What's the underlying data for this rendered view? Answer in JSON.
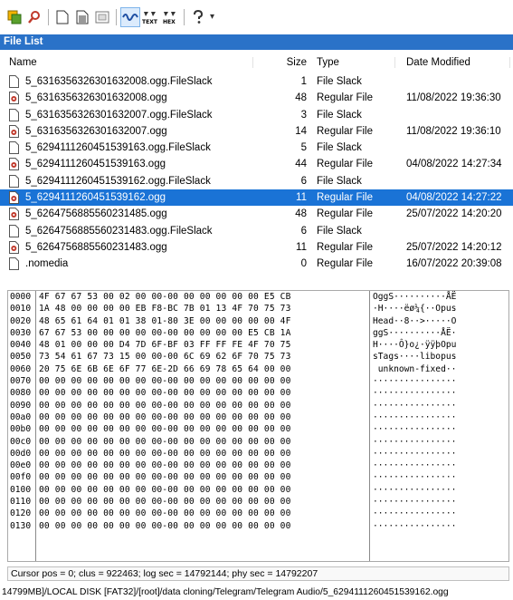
{
  "toolbar": {
    "icons": [
      "copy-icon",
      "search-icon",
      "blank-page-icon",
      "document-icon",
      "image-icon",
      "wave-icon",
      "text-view-icon",
      "hex-view-icon",
      "help-icon"
    ]
  },
  "file_list": {
    "title": "File List",
    "columns": {
      "name": "Name",
      "size": "Size",
      "type": "Type",
      "date": "Date Modified"
    },
    "rows": [
      {
        "name": "5_6316356326301632008.ogg.FileSlack",
        "size": "1",
        "type": "File Slack",
        "date": "",
        "icon": "page-icon"
      },
      {
        "name": "5_6316356326301632008.ogg",
        "size": "48",
        "type": "Regular File",
        "date": "11/08/2022 19:36:30",
        "icon": "audio-file-icon"
      },
      {
        "name": "5_6316356326301632007.ogg.FileSlack",
        "size": "3",
        "type": "File Slack",
        "date": "",
        "icon": "page-icon"
      },
      {
        "name": "5_6316356326301632007.ogg",
        "size": "14",
        "type": "Regular File",
        "date": "11/08/2022 19:36:10",
        "icon": "audio-file-icon"
      },
      {
        "name": "5_6294111260451539163.ogg.FileSlack",
        "size": "5",
        "type": "File Slack",
        "date": "",
        "icon": "page-icon"
      },
      {
        "name": "5_6294111260451539163.ogg",
        "size": "44",
        "type": "Regular File",
        "date": "04/08/2022 14:27:34",
        "icon": "audio-file-icon"
      },
      {
        "name": "5_6294111260451539162.ogg.FileSlack",
        "size": "6",
        "type": "File Slack",
        "date": "",
        "icon": "page-icon"
      },
      {
        "name": "5_6294111260451539162.ogg",
        "size": "11",
        "type": "Regular File",
        "date": "04/08/2022 14:27:22",
        "icon": "audio-file-icon",
        "selected": true
      },
      {
        "name": "5_6264756885560231485.ogg",
        "size": "48",
        "type": "Regular File",
        "date": "25/07/2022 14:20:20",
        "icon": "audio-file-icon"
      },
      {
        "name": "5_6264756885560231483.ogg.FileSlack",
        "size": "6",
        "type": "File Slack",
        "date": "",
        "icon": "page-icon"
      },
      {
        "name": "5_6264756885560231483.ogg",
        "size": "11",
        "type": "Regular File",
        "date": "25/07/2022 14:20:12",
        "icon": "audio-file-icon"
      },
      {
        "name": ".nomedia",
        "size": "0",
        "type": "Regular File",
        "date": "16/07/2022 20:39:08",
        "icon": "page-icon"
      }
    ]
  },
  "hex_view": {
    "lines": [
      {
        "offset": "0000",
        "bytes": "4F 67 67 53 00 02 00 00-00 00 00 00 00 00 E5 CB",
        "ascii": "OggS··········ÅË"
      },
      {
        "offset": "0010",
        "bytes": "1A 48 00 00 00 00 EB F8-BC 7B 01 13 4F 70 75 73",
        "ascii": "·H····ëø¼{··Opus"
      },
      {
        "offset": "0020",
        "bytes": "48 65 61 64 01 01 38 01-80 3E 00 00 00 00 00 4F",
        "ascii": "Head··8··>·····O"
      },
      {
        "offset": "0030",
        "bytes": "67 67 53 00 00 00 00 00-00 00 00 00 00 E5 CB 1A",
        "ascii": "ggS··········ÅË·"
      },
      {
        "offset": "0040",
        "bytes": "48 01 00 00 00 D4 7D 6F-BF 03 FF FF FE 4F 70 75",
        "ascii": "H····Ô}o¿·ÿÿþOpu"
      },
      {
        "offset": "0050",
        "bytes": "73 54 61 67 73 15 00 00-00 6C 69 62 6F 70 75 73",
        "ascii": "sTags····libopus"
      },
      {
        "offset": "0060",
        "bytes": "20 75 6E 6B 6E 6F 77 6E-2D 66 69 78 65 64 00 00",
        "ascii": " unknown-fixed··"
      },
      {
        "offset": "0070",
        "bytes": "00 00 00 00 00 00 00 00-00 00 00 00 00 00 00 00",
        "ascii": "················"
      },
      {
        "offset": "0080",
        "bytes": "00 00 00 00 00 00 00 00-00 00 00 00 00 00 00 00",
        "ascii": "················"
      },
      {
        "offset": "0090",
        "bytes": "00 00 00 00 00 00 00 00-00 00 00 00 00 00 00 00",
        "ascii": "················"
      },
      {
        "offset": "00a0",
        "bytes": "00 00 00 00 00 00 00 00-00 00 00 00 00 00 00 00",
        "ascii": "················"
      },
      {
        "offset": "00b0",
        "bytes": "00 00 00 00 00 00 00 00-00 00 00 00 00 00 00 00",
        "ascii": "················"
      },
      {
        "offset": "00c0",
        "bytes": "00 00 00 00 00 00 00 00-00 00 00 00 00 00 00 00",
        "ascii": "················"
      },
      {
        "offset": "00d0",
        "bytes": "00 00 00 00 00 00 00 00-00 00 00 00 00 00 00 00",
        "ascii": "················"
      },
      {
        "offset": "00e0",
        "bytes": "00 00 00 00 00 00 00 00-00 00 00 00 00 00 00 00",
        "ascii": "················"
      },
      {
        "offset": "00f0",
        "bytes": "00 00 00 00 00 00 00 00-00 00 00 00 00 00 00 00",
        "ascii": "················"
      },
      {
        "offset": "0100",
        "bytes": "00 00 00 00 00 00 00 00-00 00 00 00 00 00 00 00",
        "ascii": "················"
      },
      {
        "offset": "0110",
        "bytes": "00 00 00 00 00 00 00 00-00 00 00 00 00 00 00 00",
        "ascii": "················"
      },
      {
        "offset": "0120",
        "bytes": "00 00 00 00 00 00 00 00-00 00 00 00 00 00 00 00",
        "ascii": "················"
      },
      {
        "offset": "0130",
        "bytes": "00 00 00 00 00 00 00 00-00 00 00 00 00 00 00 00",
        "ascii": "················"
      }
    ]
  },
  "status": {
    "text": "Cursor pos = 0; clus = 922463; log sec = 14792144; phy sec = 14792207",
    "path": "14799MB]/LOCAL DISK [FAT32]/[root]/data cloning/Telegram/Telegram Audio/5_6294111260451539162.ogg"
  },
  "colors": {
    "title_bar": "#2a72c8",
    "selection": "#1a73d6"
  }
}
